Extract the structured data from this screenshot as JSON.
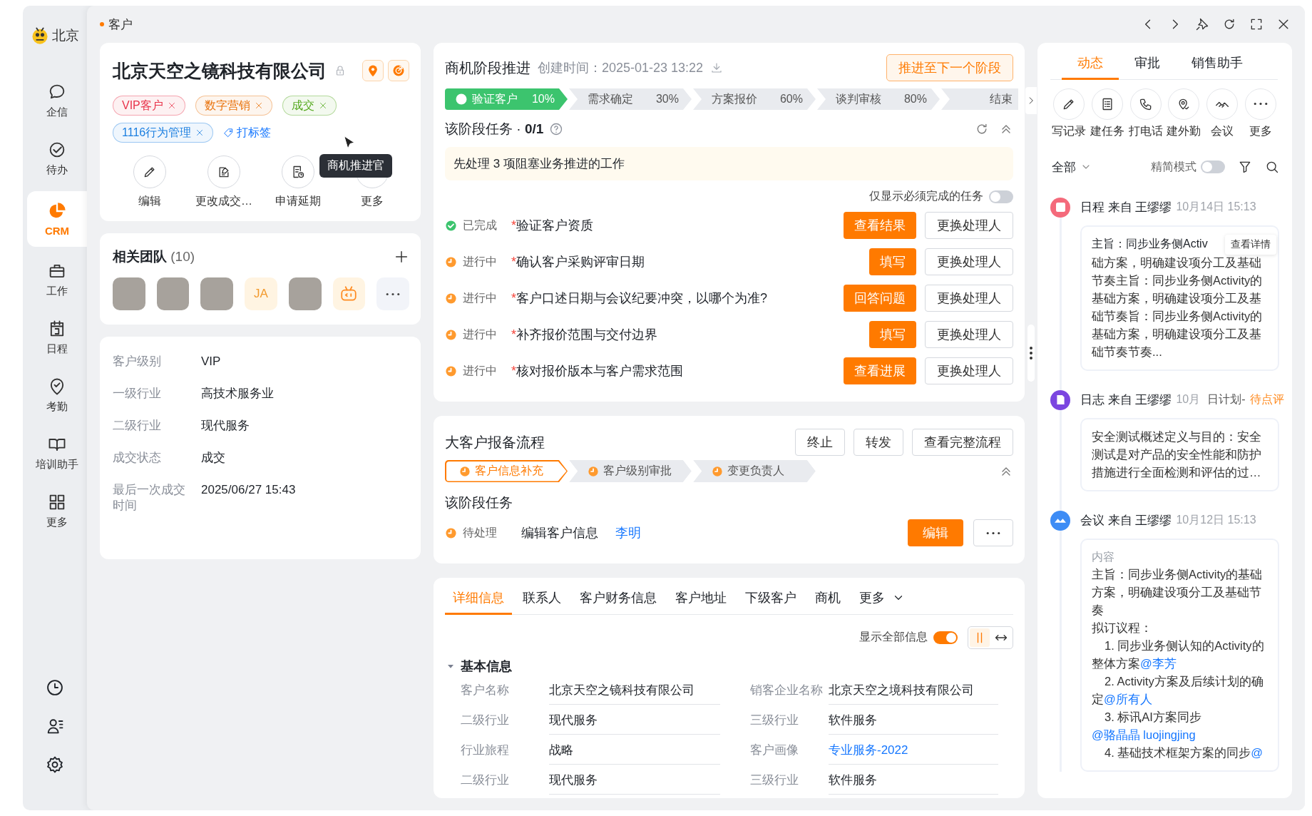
{
  "logo": {
    "text": "北京"
  },
  "nav": {
    "items": [
      {
        "label": "企信",
        "selected": false
      },
      {
        "label": "待办",
        "selected": false
      },
      {
        "label": "CRM",
        "selected": true
      },
      {
        "label": "工作",
        "selected": false
      },
      {
        "label": "日程",
        "selected": false
      },
      {
        "label": "考勤",
        "selected": false
      },
      {
        "label": "培训助手",
        "selected": false
      },
      {
        "label": "更多",
        "selected": false
      }
    ]
  },
  "breadcrumb": "客户",
  "customer": {
    "name": "北京天空之镜科技有限公司",
    "tags": [
      {
        "label": "VIP客户",
        "color": "#e8334a"
      },
      {
        "label": "数字营销",
        "color": "#e9730c"
      },
      {
        "label": "成交",
        "color": "#52a81b"
      },
      {
        "label": "1116行为管理",
        "color": "#1c7fe0"
      }
    ],
    "add_tag": "打标签",
    "actions": [
      {
        "label": "编辑"
      },
      {
        "label": "更改成交…"
      },
      {
        "label": "申请延期"
      },
      {
        "label": "更多"
      }
    ],
    "tooltip": "商机推进官"
  },
  "team": {
    "title": "**相关团队** (10)",
    "members": [
      {
        "kind": "photo"
      },
      {
        "kind": "photo"
      },
      {
        "kind": "photo"
      },
      {
        "kind": "initials",
        "text": "JA"
      },
      {
        "kind": "photo"
      },
      {
        "kind": "bot"
      },
      {
        "kind": "more"
      }
    ]
  },
  "profile": [
    {
      "label": "客户级别",
      "value": "VIP"
    },
    {
      "label": "一级行业",
      "value": "高技术服务业"
    },
    {
      "label": "二级行业",
      "value": "现代服务"
    },
    {
      "label": "成交状态",
      "value": "成交"
    },
    {
      "label": "最后一次成交时间",
      "value": "2025/06/27 15:43"
    }
  ],
  "opportunity": {
    "title": "商机阶段推进",
    "created": "创建时间：2025-01-23 13:22",
    "advance": "推进至下一个阶段",
    "stages": [
      {
        "label": "验证客户",
        "percent": "10%",
        "selected": true
      },
      {
        "label": "需求确定",
        "percent": "30%",
        "selected": false
      },
      {
        "label": "方案报价",
        "percent": "60%",
        "selected": false
      },
      {
        "label": "谈判审核",
        "percent": "80%",
        "selected": false
      },
      {
        "label": "结束",
        "selected": false
      }
    ],
    "tasks_title": "该阶段任务 · **0/1**",
    "notice": "先处理 3 项阻塞业务推进的工作",
    "required_only": {
      "label": "仅显示必须完成的任务",
      "on": false
    },
    "tasks": [
      {
        "kind": "done",
        "status_label": "已完成",
        "mark": "*",
        "title": "验证客户资质",
        "action": "查看结果",
        "reassign": "更换处理人"
      },
      {
        "kind": "in_progress",
        "status_label": "进行中",
        "mark": "*",
        "title": "确认客户采购评审日期",
        "action": "填写",
        "reassign": "更换处理人"
      },
      {
        "kind": "in_progress",
        "status_label": "进行中",
        "mark": "*",
        "title": "客户口述日期与会议纪要冲突，以哪个为准?",
        "action": "回答问题",
        "reassign": "更换处理人"
      },
      {
        "kind": "in_progress",
        "status_label": "进行中",
        "mark": "*",
        "title": "补齐报价范围与交付边界",
        "action": "填写",
        "reassign": "更换处理人"
      },
      {
        "kind": "in_progress",
        "status_label": "进行中",
        "mark": "*",
        "title": "核对报价版本与客户需求范围",
        "action": "查看进展",
        "reassign": "更换处理人"
      }
    ]
  },
  "process": {
    "title": "大客户报备流程",
    "buttons": [
      "终止",
      "转发",
      "查看完整流程"
    ],
    "steps": [
      {
        "label": "客户信息补充",
        "selected": true
      },
      {
        "label": "客户级别审批",
        "selected": false
      },
      {
        "label": "变更负责人",
        "selected": false
      }
    ],
    "tasks_title": "该阶段任务",
    "task": {
      "kind": "pending",
      "status_label": "待处理",
      "title": "编辑客户信息",
      "assignee": "李明",
      "action": "编辑"
    }
  },
  "details": {
    "tabs": [
      {
        "label": "详细信息",
        "selected": true
      },
      {
        "label": "联系人",
        "selected": false
      },
      {
        "label": "客户财务信息",
        "selected": false
      },
      {
        "label": "客户地址",
        "selected": false
      },
      {
        "label": "下级客户",
        "selected": false
      },
      {
        "label": "商机",
        "selected": false
      },
      {
        "label": "更多",
        "selected": false,
        "kind": "dropdown"
      }
    ],
    "show_all": {
      "label": "显示全部信息",
      "on": true
    },
    "views": [
      {
        "selected": true
      },
      {
        "selected": false
      }
    ],
    "section": {
      "title": "基本信息",
      "expanded": true
    },
    "fields": [
      {
        "label": "客户名称",
        "value": "北京天空之镜科技有限公司",
        "kind": "text"
      },
      {
        "label": "销客企业名称",
        "value": "北京天空之境科技有限公司",
        "kind": "text"
      },
      {
        "label": "二级行业",
        "value": "现代服务",
        "kind": "text"
      },
      {
        "label": "三级行业",
        "value": "软件服务",
        "kind": "text"
      },
      {
        "label": "行业旅程",
        "value": "战略",
        "kind": "text"
      },
      {
        "label": "客户画像",
        "value": "专业服务-2022",
        "kind": "link"
      },
      {
        "label": "二级行业",
        "value": "现代服务",
        "kind": "text"
      },
      {
        "label": "三级行业",
        "value": "软件服务",
        "kind": "text"
      }
    ]
  },
  "activity": {
    "tabs": [
      {
        "label": "动态",
        "selected": true
      },
      {
        "label": "审批",
        "selected": false
      },
      {
        "label": "销售助手",
        "selected": false
      }
    ],
    "actions": [
      {
        "label": "写记录"
      },
      {
        "label": "建任务"
      },
      {
        "label": "打电话"
      },
      {
        "label": "建外勤"
      },
      {
        "label": "会议"
      },
      {
        "label": "更多"
      }
    ],
    "filter": "全部",
    "compact": {
      "label": "精简模式",
      "on": false
    },
    "entries": [
      {
        "kind": "schedule",
        "color": "#f46a7b",
        "title": "日程 来自 王缪缪",
        "time": "10月14日 15:13",
        "lead": "主旨：同步业务侧Activ",
        "detail_button": "查看详情",
        "body": "础方案，明确建设项分工及基础节奏主旨：同步业务侧Activity的基础方案，明确建设项分工及基础节奏旨：同步业务侧Activity的基础方案，明确建设项分工及基础节奏节奏..."
      },
      {
        "kind": "log",
        "color": "#7b46e0",
        "title": "日志 来自 王缪缪",
        "time": "10月",
        "plan": "日计划-",
        "review": "待点评",
        "body": "安全测试概述定义与目的：安全测试是对产品的安全性能和防护措施进行全面检测和评估的过…"
      },
      {
        "kind": "meeting",
        "color": "#3d8cf5",
        "title": "会议 来自 王缪缪",
        "time": "10月12日 15:13",
        "caption": "内容",
        "lines": [
          {
            "kind": "text",
            "parts": [
              {
                "kind": "text",
                "text": "主旨：同步业务侧Activity的基础方案，明确建设项分工及基础节奏"
              }
            ]
          },
          {
            "kind": "text",
            "parts": [
              {
                "kind": "text",
                "text": "拟订议程："
              }
            ]
          },
          {
            "kind": "item",
            "parts": [
              {
                "kind": "text",
                "text": "1. 同步业务侧认知的Activity的整体方案"
              },
              {
                "kind": "mention",
                "text": "@李芳"
              }
            ]
          },
          {
            "kind": "item",
            "parts": [
              {
                "kind": "text",
                "text": "2. Activity方案及后续计划的确定"
              },
              {
                "kind": "mention",
                "text": "@所有人"
              }
            ]
          },
          {
            "kind": "item",
            "parts": [
              {
                "kind": "text",
                "text": "3. 标讯AI方案同步"
              },
              {
                "kind": "mention",
                "text": "@骆晶晶"
              },
              {
                "kind": "mention",
                "text": " luojingjing"
              }
            ]
          },
          {
            "kind": "item",
            "parts": [
              {
                "kind": "text",
                "text": "4. 基础技术框架方案的同步"
              },
              {
                "kind": "mention",
                "text": "@"
              }
            ]
          }
        ]
      }
    ]
  }
}
